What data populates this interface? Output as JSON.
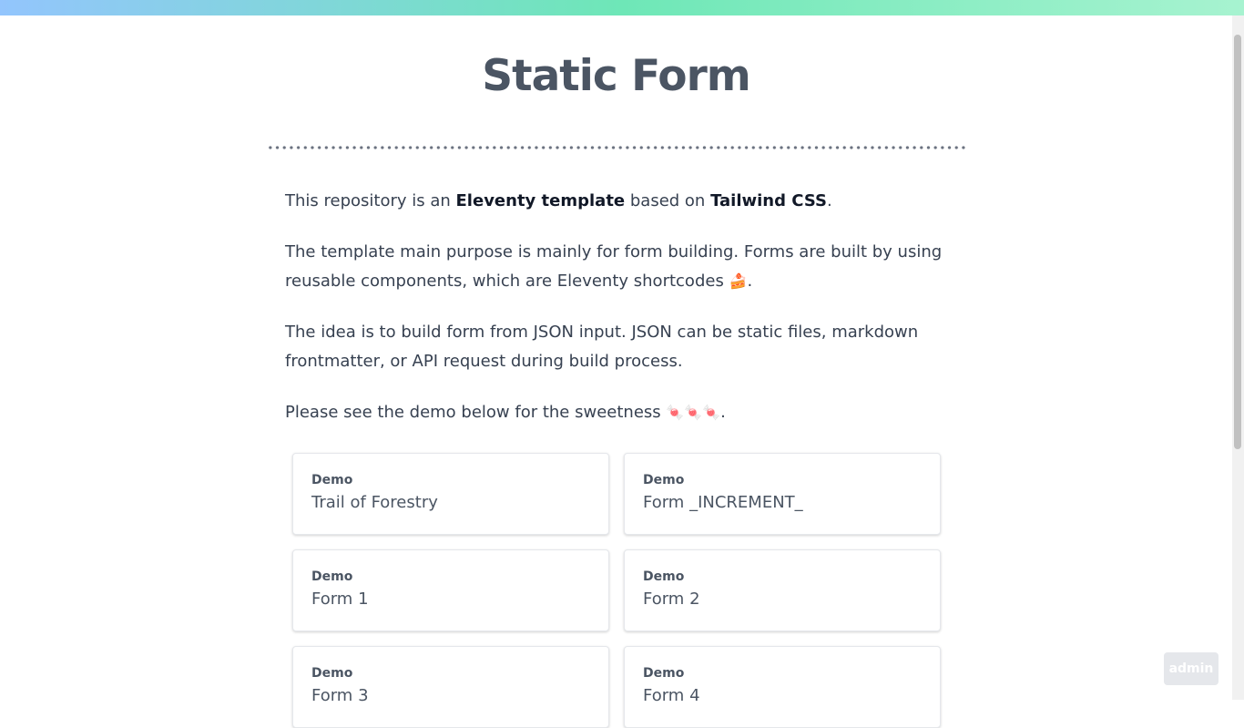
{
  "page": {
    "title": "Static Form"
  },
  "intro": {
    "p1_before": "This repository is an ",
    "p1_bold1": "Eleventy template",
    "p1_middle": " based on ",
    "p1_bold2": "Tailwind CSS",
    "p1_after": ".",
    "p2_text": "The template main purpose is mainly for form building. Forms are built by using reusable components, which are Eleventy shortcodes ",
    "p2_emoji": "🍰",
    "p2_after": ".",
    "p3_text": "The idea is to build form from JSON input. JSON can be static files, markdown frontmatter, or API request during build process.",
    "p4_text": "Please see the demo below for the sweetness ",
    "p4_emoji": "🍬🍬🍬",
    "p4_after": "."
  },
  "cards": [
    {
      "kicker": "Demo",
      "title": "Trail of Forestry"
    },
    {
      "kicker": "Demo",
      "title": "Form _INCREMENT_"
    },
    {
      "kicker": "Demo",
      "title": "Form 1"
    },
    {
      "kicker": "Demo",
      "title": "Form 2"
    },
    {
      "kicker": "Demo",
      "title": "Form 3"
    },
    {
      "kicker": "Demo",
      "title": "Form 4"
    }
  ],
  "admin": {
    "label": "admin"
  },
  "colors": {
    "gradient_start": "#93c5fd",
    "gradient_mid": "#6ee7b7",
    "gradient_end": "#a7f3d0",
    "heading": "#4b5563",
    "body_text": "#374151"
  }
}
